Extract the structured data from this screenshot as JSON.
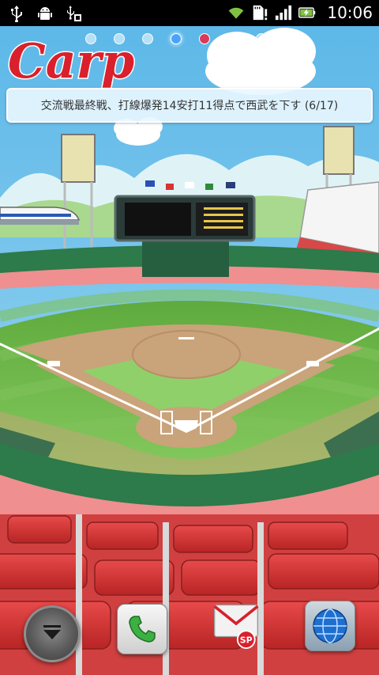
{
  "status_bar": {
    "left_icons": [
      "usb-icon",
      "android-debug-icon",
      "usb-storage-icon"
    ],
    "right_icons": [
      "wifi-icon",
      "sd-card-alert-icon",
      "signal-icon",
      "battery-charging-icon"
    ],
    "time": "10:06"
  },
  "home": {
    "page_indicator": {
      "count": 8,
      "active_index": 3,
      "home_index": 4
    }
  },
  "widget": {
    "logo_text": "Carp",
    "news_text": "交流戦最終戦、打線爆発14安打11得点で西武を下す (6/17)"
  },
  "dock": {
    "items": [
      {
        "name": "app-drawer-button",
        "icon": "chevron-down-icon"
      },
      {
        "name": "phone-button",
        "icon": "phone-icon"
      },
      {
        "name": "mail-button",
        "icon": "mail-icon",
        "badge": "SP"
      },
      {
        "name": "browser-button",
        "icon": "globe-icon"
      }
    ]
  },
  "colors": {
    "accent_red": "#d9202c",
    "sky": "#7ec8ea",
    "grass": "#6fbf4f",
    "dirt": "#c9a37a"
  }
}
